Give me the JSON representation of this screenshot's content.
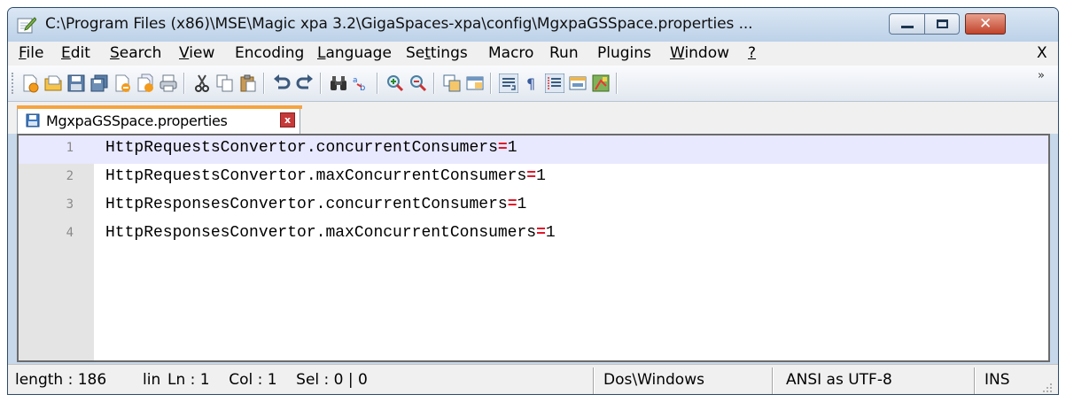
{
  "window": {
    "title": "C:\\Program Files (x86)\\MSE\\Magic xpa 3.2\\GigaSpaces-xpa\\config\\MgxpaGSSpace.properties ..."
  },
  "menu": {
    "items": [
      {
        "pre": "",
        "key": "F",
        "post": "ile"
      },
      {
        "pre": "",
        "key": "E",
        "post": "dit"
      },
      {
        "pre": "",
        "key": "S",
        "post": "earch"
      },
      {
        "pre": "",
        "key": "V",
        "post": "iew"
      },
      {
        "pre": "Encoding",
        "key": "",
        "post": ""
      },
      {
        "pre": "",
        "key": "L",
        "post": "anguage"
      },
      {
        "pre": "Se",
        "key": "t",
        "post": "tings"
      },
      {
        "pre": "Macro",
        "key": "",
        "post": ""
      },
      {
        "pre": "Run",
        "key": "",
        "post": ""
      },
      {
        "pre": "Plugins",
        "key": "",
        "post": ""
      },
      {
        "pre": "",
        "key": "W",
        "post": "indow"
      },
      {
        "pre": "",
        "key": "?",
        "post": ""
      }
    ],
    "close_label": "X"
  },
  "toolbar": {
    "more_label": "»"
  },
  "tab": {
    "label": "MgxpaGSSpace.properties",
    "close_label": "x"
  },
  "editor": {
    "lines": [
      {
        "num": "1",
        "key": "HttpRequestsConvertor.concurrentConsumers",
        "op": "=",
        "value": "1"
      },
      {
        "num": "2",
        "key": "HttpRequestsConvertor.maxConcurrentConsumers",
        "op": "=",
        "value": "1"
      },
      {
        "num": "3",
        "key": "HttpResponsesConvertor.concurrentConsumers",
        "op": "=",
        "value": "1"
      },
      {
        "num": "4",
        "key": "HttpResponsesConvertor.maxConcurrentConsumers",
        "op": "=",
        "value": "1"
      }
    ]
  },
  "status": {
    "length": "length : 186",
    "lines": "lin",
    "position": "Ln : 1    Col : 1    Sel : 0 | 0",
    "eol": "Dos\\Windows",
    "encoding": "ANSI as UTF-8",
    "mode": "INS"
  }
}
